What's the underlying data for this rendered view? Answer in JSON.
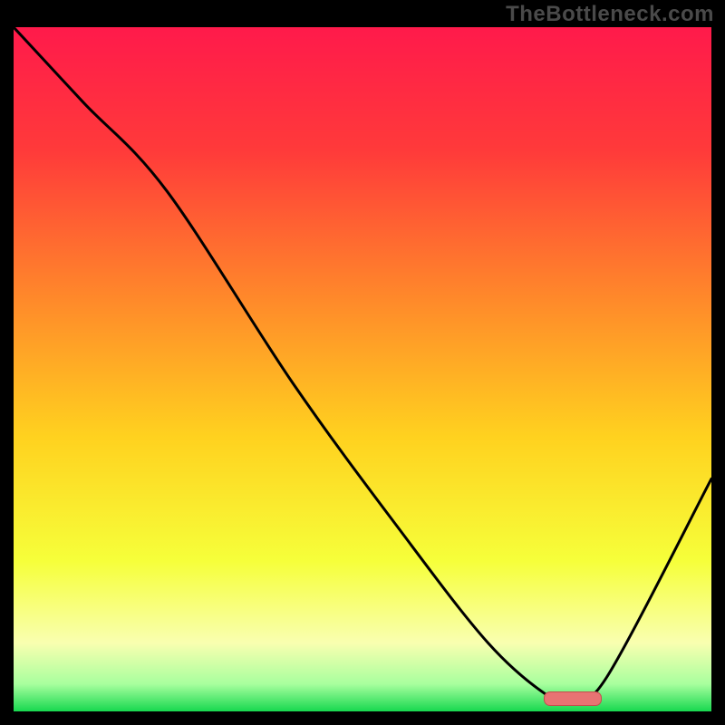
{
  "watermark": "TheBottleneck.com",
  "chart_data": {
    "type": "line",
    "title": "",
    "xlabel": "",
    "ylabel": "",
    "xlim": [
      0,
      100
    ],
    "ylim": [
      0,
      100
    ],
    "grid": false,
    "series": [
      {
        "name": "bottleneck-curve",
        "x": [
          0,
          10,
          22,
          40,
          55,
          68,
          77,
          80,
          85,
          100
        ],
        "values": [
          100,
          89,
          76,
          48,
          27,
          10,
          2,
          2,
          5,
          34
        ]
      }
    ],
    "marker": {
      "name": "optimal-range",
      "x_start": 76,
      "x_end": 84,
      "y": 2,
      "fill": "#e87373",
      "stroke": "#c0504d"
    },
    "background_gradient": {
      "stops": [
        {
          "offset": 0.0,
          "color": "#ff1a4b"
        },
        {
          "offset": 0.18,
          "color": "#ff3a3a"
        },
        {
          "offset": 0.4,
          "color": "#ff8a2a"
        },
        {
          "offset": 0.6,
          "color": "#ffd21f"
        },
        {
          "offset": 0.78,
          "color": "#f6ff3a"
        },
        {
          "offset": 0.9,
          "color": "#f9ffb0"
        },
        {
          "offset": 0.96,
          "color": "#a8ff9e"
        },
        {
          "offset": 1.0,
          "color": "#17d84f"
        }
      ]
    }
  }
}
